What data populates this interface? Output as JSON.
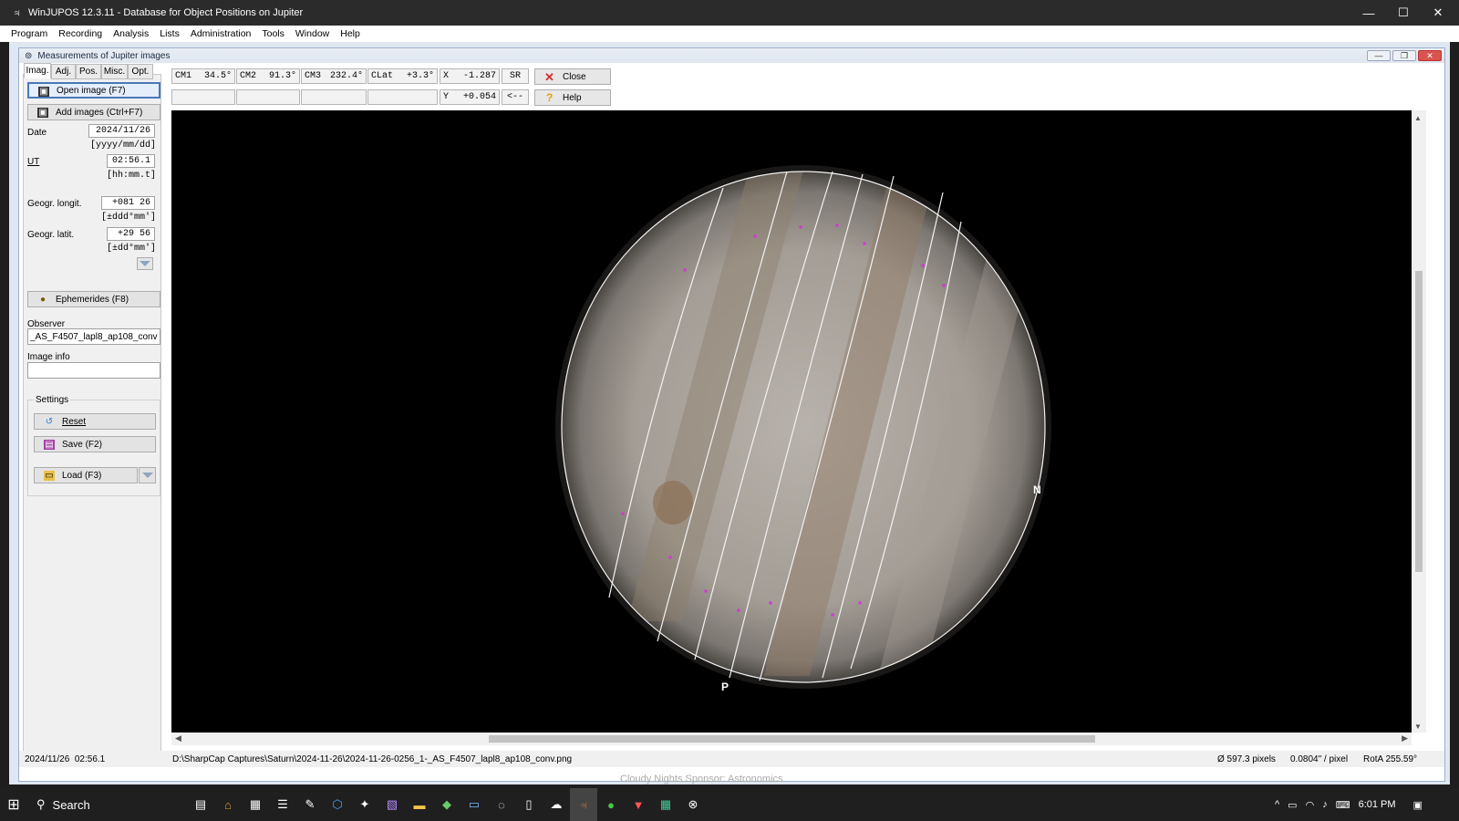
{
  "window": {
    "title": "WinJUPOS 12.3.11 - Database for Object Positions on Jupiter",
    "min": "—",
    "max": "☐",
    "close": "✕"
  },
  "menu": [
    "Program",
    "Recording",
    "Analysis",
    "Lists",
    "Administration",
    "Tools",
    "Window",
    "Help"
  ],
  "child": {
    "title": "Measurements of Jupiter images",
    "min": "—",
    "max": "❐",
    "close": "✕"
  },
  "tabs": [
    "Imag.",
    "Adj.",
    "Pos.",
    "Misc.",
    "Opt."
  ],
  "left": {
    "open_image": "Open image (F7)",
    "add_images": "Add images (Ctrl+F7)",
    "date_label": "Date",
    "date_value": "2024/11/26",
    "date_hint": "[yyyy/mm/dd]",
    "ut_label": "UT",
    "ut_value": "02:56.1",
    "ut_hint": "[hh:mm.t]",
    "longit_label": "Geogr. longit.",
    "longit_value": "+081 26",
    "longit_hint": "[±ddd°mm']",
    "latit_label": "Geogr. latit.",
    "latit_value": "+29 56",
    "latit_hint": "[±dd°mm']",
    "ephemerides": "Ephemerides (F8)",
    "observer_label": "Observer",
    "observer_value": "_AS_F4507_lapl8_ap108_conv",
    "imageinfo_label": "Image info",
    "imageinfo_value": "",
    "settings_label": "Settings",
    "reset": "Reset",
    "save": "Save (F2)",
    "load": "Load (F3)"
  },
  "toolbar": {
    "cm1_label": "CM1",
    "cm1_value": "34.5°",
    "cm2_label": "CM2",
    "cm2_value": "91.3°",
    "cm3_label": "CM3",
    "cm3_value": "232.4°",
    "clat_label": "CLat",
    "clat_value": "+3.3°",
    "x_label": "X",
    "x_value": "-1.287",
    "y_label": "Y",
    "y_value": "+0.054",
    "sr": "SR",
    "arrow": "<--",
    "close": "Close",
    "help": "Help"
  },
  "image": {
    "north_label": "N",
    "p_label": "P"
  },
  "status": {
    "datetime": "2024/11/26  02:56.1",
    "path": "D:\\SharpCap Captures\\Saturn\\2024-11-26\\2024-11-26-0256_1-_AS_F4507_lapl8_ap108_conv.png",
    "diameter": "Ø 597.3 pixels",
    "scale": "0.0804\" / pixel",
    "rota": "RotA 255.59°"
  },
  "taskbar": {
    "search": "Search",
    "time": "6:01 PM",
    "banner": "Cloudy Nights Sponsor: Astronomics"
  }
}
